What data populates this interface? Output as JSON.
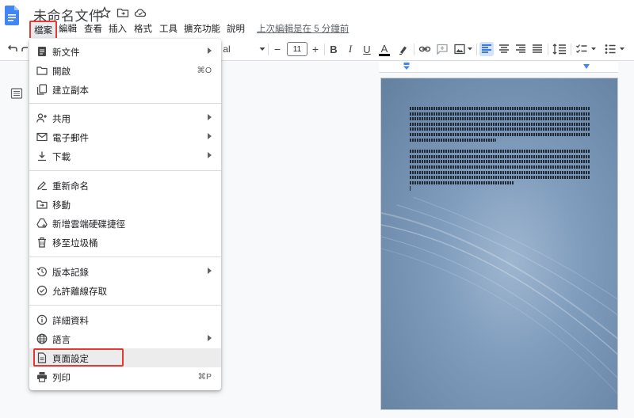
{
  "header": {
    "title": "未命名文件",
    "last_edit": "上次編輯是在 5 分鐘前"
  },
  "menubar": {
    "items": [
      "檔案",
      "編輯",
      "查看",
      "插入",
      "格式",
      "工具",
      "擴充功能",
      "說明"
    ]
  },
  "toolbar": {
    "font_name_fragment": "al",
    "font_size": "11",
    "bold": "B",
    "italic": "I",
    "underline": "U",
    "text_color": "A",
    "minus": "−",
    "plus": "+"
  },
  "file_menu": {
    "items": [
      {
        "label": "新文件",
        "icon": "document-icon",
        "submenu": true
      },
      {
        "label": "開啟",
        "icon": "folder-open-icon",
        "shortcut": "⌘O"
      },
      {
        "label": "建立副本",
        "icon": "copy-icon"
      },
      {
        "label": "共用",
        "icon": "person-add-icon",
        "submenu": true
      },
      {
        "label": "電子郵件",
        "icon": "email-icon",
        "submenu": true
      },
      {
        "label": "下載",
        "icon": "download-icon",
        "submenu": true
      },
      {
        "label": "重新命名",
        "icon": "rename-icon"
      },
      {
        "label": "移動",
        "icon": "move-icon"
      },
      {
        "label": "新增雲端硬碟捷徑",
        "icon": "drive-shortcut-icon"
      },
      {
        "label": "移至垃圾桶",
        "icon": "trash-icon"
      },
      {
        "label": "版本記錄",
        "icon": "history-icon",
        "submenu": true
      },
      {
        "label": "允許離線存取",
        "icon": "offline-icon"
      },
      {
        "label": "詳細資料",
        "icon": "info-icon"
      },
      {
        "label": "語言",
        "icon": "globe-icon",
        "submenu": true
      },
      {
        "label": "頁面設定",
        "icon": "page-setup-icon"
      },
      {
        "label": "列印",
        "icon": "print-icon",
        "shortcut": "⌘P"
      }
    ]
  },
  "colors": {
    "highlight_border": "#e53935",
    "docs_blue": "#4285f4",
    "page_background": "#7f9cbd"
  }
}
